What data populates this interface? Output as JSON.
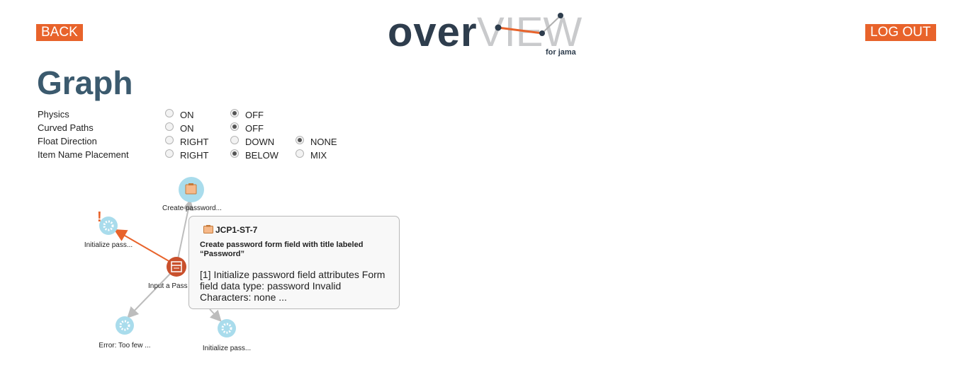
{
  "header": {
    "back_label": "BACK",
    "logout_label": "LOG OUT",
    "logo": {
      "over": "over",
      "view": "VIEW",
      "subtitle": "for jama"
    }
  },
  "page_title": "Graph",
  "options": [
    {
      "label": "Physics",
      "choices": [
        {
          "text": "ON",
          "checked": false
        },
        {
          "text": "OFF",
          "checked": true
        }
      ]
    },
    {
      "label": "Curved Paths",
      "choices": [
        {
          "text": "ON",
          "checked": false
        },
        {
          "text": "OFF",
          "checked": true
        }
      ]
    },
    {
      "label": "Float Direction",
      "choices": [
        {
          "text": "RIGHT",
          "checked": false
        },
        {
          "text": "DOWN",
          "checked": false
        },
        {
          "text": "NONE",
          "checked": true
        }
      ]
    },
    {
      "label": "Item Name Placement",
      "choices": [
        {
          "text": "RIGHT",
          "checked": false
        },
        {
          "text": "BELOW",
          "checked": true
        },
        {
          "text": "MIX",
          "checked": false
        }
      ]
    }
  ],
  "graph": {
    "nodes": {
      "top": "Create password...",
      "left_warn": "Initialize pass...",
      "center": "Input a Pass",
      "bottom_left": "Error: Too few ...",
      "bottom_right": "Initialize pass..."
    },
    "warning_mark": "!"
  },
  "tooltip": {
    "id": "JCP1-ST-7",
    "title": "Create password form field with title labeled “Password”",
    "description": "[1] Initialize password field attributes Form field data type: password Invalid Characters: none ..."
  },
  "colors": {
    "accent": "#e8632b",
    "title": "#3b5a6e",
    "node_fill": "#a9dcec",
    "center_node": "#c9502c"
  }
}
